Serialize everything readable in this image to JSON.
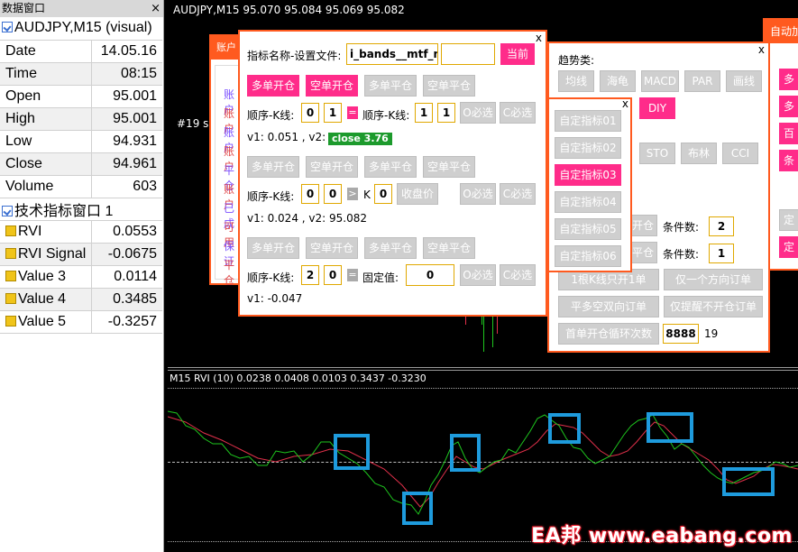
{
  "data_window": {
    "title": "数据窗口",
    "close": "×",
    "symbol_header": "AUDJPY,M15 (visual)",
    "rows": [
      {
        "label": "Date",
        "value": "14.05.16"
      },
      {
        "label": "Time",
        "value": "08:15"
      },
      {
        "label": "Open",
        "value": "95.001"
      },
      {
        "label": "High",
        "value": "95.001"
      },
      {
        "label": "Low",
        "value": "94.931"
      },
      {
        "label": "Close",
        "value": "94.961"
      },
      {
        "label": "Volume",
        "value": "603"
      }
    ],
    "indicator_header": "技术指标窗口 1",
    "indicator_rows": [
      {
        "label": "RVI",
        "value": "0.0553"
      },
      {
        "label": "RVI Signal",
        "value": "-0.0675"
      },
      {
        "label": "Value 3",
        "value": "0.0114"
      },
      {
        "label": "Value 4",
        "value": "0.3485"
      },
      {
        "label": "Value 5",
        "value": "-0.3257"
      }
    ]
  },
  "chart": {
    "title": "AUDJPY,M15  95.070 95.084 95.069 95.082",
    "order_label": "#19 s",
    "rvi_label": "M15 RVI (10) 0.0238 0.0408 0.0103 0.3437 -0.3230",
    "watermark": "EA邦 www.eabang.com",
    "colors": {
      "up": "#1ec61e",
      "down": "#e0304a",
      "box": "#1e9bdd"
    }
  },
  "account_panel": {
    "title": "账户",
    "rows": [
      "账户",
      "账户",
      "账户",
      "账户",
      "平仓",
      "账户",
      "已成",
      "可用",
      "保证",
      "平仓"
    ]
  },
  "auto_panel": {
    "title": "自动加"
  },
  "right_panel_btns": [
    "多",
    "多",
    "百",
    "条",
    "定",
    "定"
  ],
  "indicator_panel": {
    "close": "x",
    "name_label": "指标名称-设置文件:",
    "name_value": "i_bands__mtf_nm",
    "current_btn": "当前",
    "sec1": {
      "btns": [
        "多单开仓",
        "空单开仓",
        "多单平仓",
        "空单平仓"
      ],
      "order_label1": "顺序-K线:",
      "v1": "0",
      "v2": "1",
      "op": "=",
      "order_label2": "顺序-K线:",
      "v3": "1",
      "v4": "1",
      "o_btn": "O必选",
      "c_btn": "C必选",
      "readout": "v1: 0.051 , v2: 0",
      "badge": "close 3.76"
    },
    "sec2": {
      "btns": [
        "多单开仓",
        "空单开仓",
        "多单平仓",
        "空单平仓"
      ],
      "order_label1": "顺序-K线:",
      "v1": "0",
      "v2": "0",
      "op": ">",
      "k_label": "K",
      "v3": "0",
      "close_btn": "收盘价",
      "o_btn": "O必选",
      "c_btn": "C必选",
      "readout": "v1: 0.024 , v2: 95.082"
    },
    "sec3": {
      "btns": [
        "多单开仓",
        "空单开仓",
        "多单平仓",
        "空单平仓"
      ],
      "order_label1": "顺序-K线:",
      "v1": "2",
      "v2": "0",
      "op": "=",
      "fixed_label": "固定值:",
      "fixed_value": "0",
      "o_btn": "O必选",
      "c_btn": "C必选",
      "readout": "v1: -0.047"
    }
  },
  "trend_panel": {
    "close": "x",
    "title": "趋势类:",
    "row1": [
      "均线",
      "海龟",
      "MACD",
      "PAR",
      "画线"
    ],
    "diy": "DIY",
    "row2": [
      "STO",
      "布林",
      "CCI"
    ],
    "cond_label1": "条件数:",
    "cond_value1": "2",
    "cond_label2": "条件数:",
    "cond_value2": "1",
    "partial1": "开仓",
    "partial2": "平仓",
    "btn_k": "1根K线只开1单",
    "btn_one_dir": "仅一个方向订单",
    "btn_flat": "平多空双向订单",
    "btn_remind": "仅提醒不开仓订单",
    "btn_loop": "首单开仓循环次数",
    "loop_value": "8888",
    "loop_count": "19"
  },
  "custom_panel": {
    "close": "x",
    "items": [
      "自定指标01",
      "自定指标02",
      "自定指标03",
      "自定指标04",
      "自定指标05",
      "自定指标06"
    ],
    "selected_index": 2
  }
}
